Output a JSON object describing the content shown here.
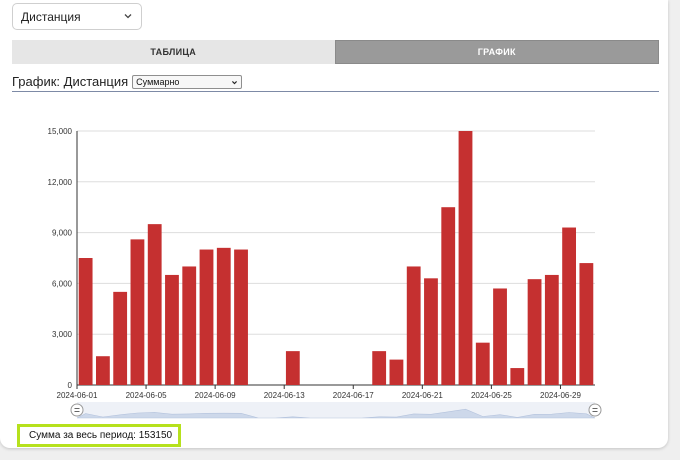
{
  "metric_select": {
    "value": "Дистанция"
  },
  "tabs": [
    {
      "label": "ТАБЛИЦА",
      "active": false
    },
    {
      "label": "ГРАФИК",
      "active": true
    }
  ],
  "chart_header": {
    "title": "График: Дистанция",
    "mode_select_value": "Суммарно"
  },
  "summary": {
    "label": "Сумма за весь период:",
    "value": "153150"
  },
  "colors": {
    "bar": "#c53030",
    "accent": "#b6e11d",
    "active_tab": "#9a9a9a"
  },
  "chart_data": {
    "type": "bar",
    "categories": [
      "2024-06-01",
      "2024-06-02",
      "2024-06-03",
      "2024-06-04",
      "2024-06-05",
      "2024-06-06",
      "2024-06-07",
      "2024-06-08",
      "2024-06-09",
      "2024-06-10",
      "2024-06-11",
      "2024-06-12",
      "2024-06-13",
      "2024-06-14",
      "2024-06-15",
      "2024-06-16",
      "2024-06-17",
      "2024-06-18",
      "2024-06-19",
      "2024-06-20",
      "2024-06-21",
      "2024-06-22",
      "2024-06-23",
      "2024-06-24",
      "2024-06-25",
      "2024-06-26",
      "2024-06-27",
      "2024-06-28",
      "2024-06-29",
      "2024-06-30"
    ],
    "values": [
      7500,
      1700,
      5500,
      8600,
      9500,
      6500,
      7000,
      8000,
      8100,
      8000,
      0,
      0,
      2000,
      0,
      0,
      0,
      0,
      2000,
      1500,
      7000,
      6300,
      10500,
      15000,
      2500,
      5700,
      1000,
      6250,
      6500,
      9300,
      7200
    ],
    "x_tick_labels": [
      "2024-06-01",
      "2024-06-05",
      "2024-06-09",
      "2024-06-13",
      "2024-06-17",
      "2024-06-21",
      "2024-06-25",
      "2024-06-29"
    ],
    "y_ticks": [
      0,
      3000,
      6000,
      9000,
      12000,
      15000
    ],
    "y_tick_labels": [
      "0",
      "3,000",
      "6,000",
      "9,000",
      "12,000",
      "15,000"
    ],
    "ylim": [
      0,
      15000
    ],
    "xlabel": "",
    "ylabel": "",
    "grid": true,
    "range_selector": true
  }
}
